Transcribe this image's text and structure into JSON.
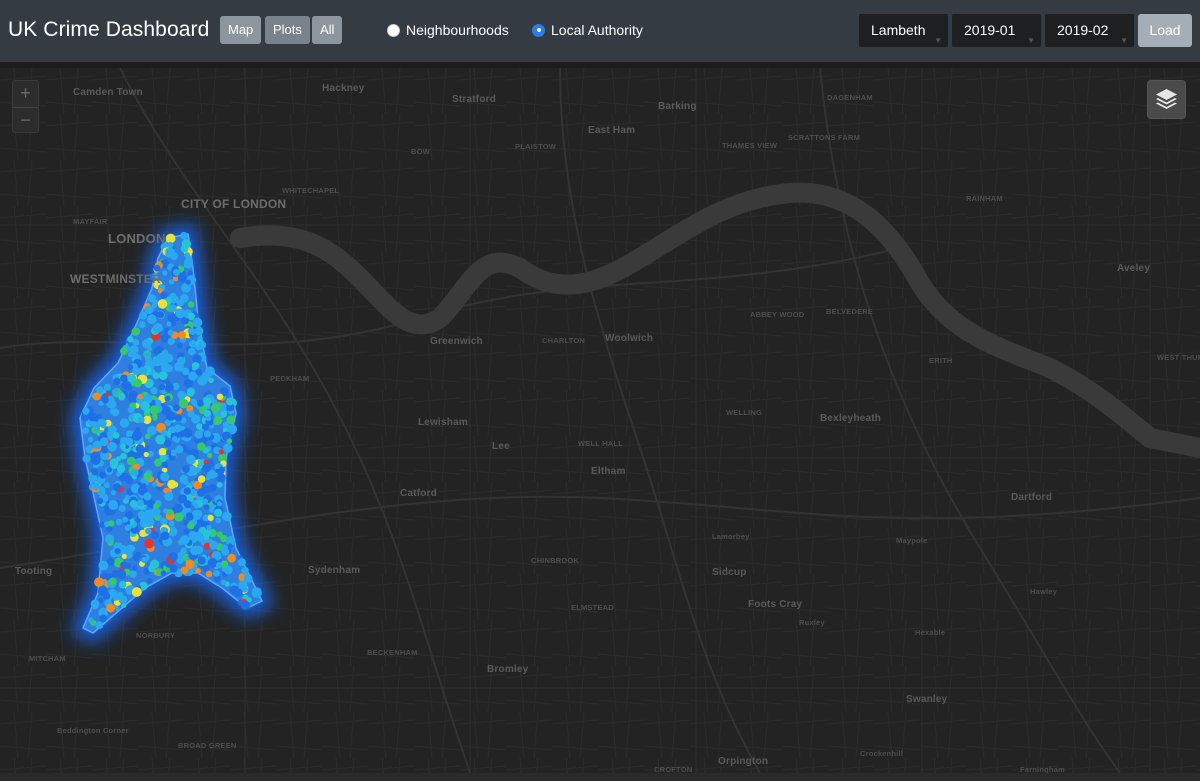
{
  "app": {
    "title": "UK Crime Dashboard"
  },
  "view_buttons": [
    {
      "label": "Map"
    },
    {
      "label": "Plots"
    },
    {
      "label": "All"
    }
  ],
  "radios": [
    {
      "label": "Neighbourhoods",
      "checked": false
    },
    {
      "label": "Local Authority",
      "checked": true
    }
  ],
  "filters": {
    "authority": "Lambeth",
    "start_month": "2019-01",
    "end_month": "2019-02",
    "load_label": "Load"
  },
  "map": {
    "zoom_in": "+",
    "zoom_out": "−",
    "labels": [
      "Camden Town",
      "Hackney",
      "Stratford",
      "Barking",
      "DAGENHAM",
      "BOW",
      "PLAISTOW",
      "East Ham",
      "THAMES VIEW",
      "SCRATTONS FARM",
      "WHITECHAPEL",
      "CITY OF LONDON",
      "MAYFAIR",
      "LONDON",
      "WESTMINSTER",
      "RAINHAM",
      "Aveley",
      "Greenwich",
      "CHARLTON",
      "Woolwich",
      "ABBEY WOOD",
      "BELVEDERE",
      "PECKHAM",
      "ERITH",
      "WEST THURROCK",
      "Lewisham",
      "Lee",
      "WELL HALL",
      "WELLING",
      "Bexleyheath",
      "Eltham",
      "Catford",
      "Dartford",
      "Lamorbey",
      "Maypole",
      "CHINBROOK",
      "Sidcup",
      "Tooting",
      "Sydenham",
      "ELMSTEAD",
      "Foots Cray",
      "Ruxley",
      "Hexable",
      "Hawley",
      "NORBURY",
      "MITCHAM",
      "BECKENHAM",
      "Bromley",
      "Swanley",
      "Beddington Corner",
      "BROAD GREEN",
      "Crockenhill",
      "Orpington",
      "CROFTON",
      "Farningham"
    ]
  },
  "colors": {
    "navbar": "#343b42",
    "map_background": "#232323",
    "thames": "#3a3a3a",
    "crime_base": "#2e7fe0",
    "crime_points": [
      "#2aa8f0",
      "#1f6fe6",
      "#27c4d8",
      "#35c96a",
      "#e8e23a",
      "#f08a22",
      "#e5322a"
    ]
  }
}
